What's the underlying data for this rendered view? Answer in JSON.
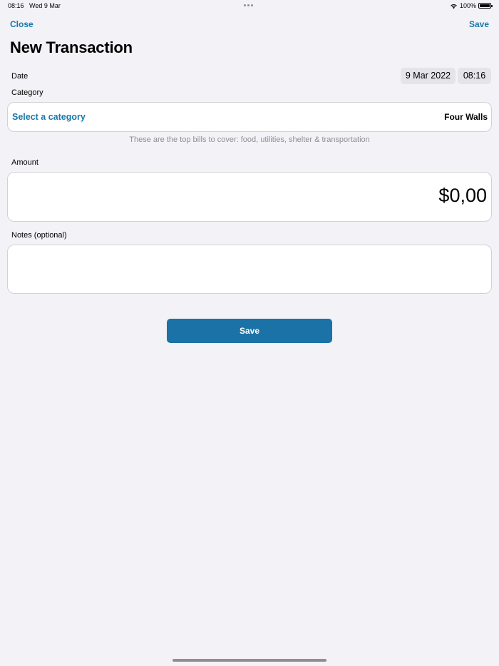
{
  "status_bar": {
    "time": "08:16",
    "date": "Wed 9 Mar",
    "battery": "100%"
  },
  "nav": {
    "close_label": "Close",
    "save_label": "Save"
  },
  "title": "New Transaction",
  "date_field": {
    "label": "Date",
    "date_value": "9 Mar 2022",
    "time_value": "08:16"
  },
  "category_field": {
    "label": "Category",
    "placeholder": "Select a category",
    "value": "Four Walls",
    "helper": "These are the top bills to cover: food, utilities, shelter & transportation"
  },
  "amount_field": {
    "label": "Amount",
    "value": "$0,00"
  },
  "notes_field": {
    "label": "Notes (optional)",
    "value": ""
  },
  "save_button_label": "Save",
  "colors": {
    "accent": "#1a78aa",
    "button": "#1a72a6",
    "background": "#f2f2f7"
  }
}
